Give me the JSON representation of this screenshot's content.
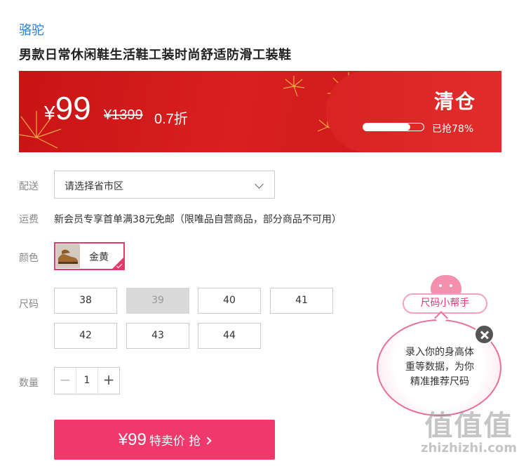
{
  "brand": "骆驼",
  "product": {
    "title": "男款日常休闲鞋生活鞋工装时尚舒适防滑工装鞋"
  },
  "banner": {
    "currency": "¥",
    "price": "99",
    "original_price": "¥1399",
    "discount": "0.7折",
    "tag": "清仓",
    "sold_progress": 0.78,
    "sold_text": "已抢78%"
  },
  "shipping": {
    "label": "配送",
    "placeholder": "请选择省市区"
  },
  "fee": {
    "label": "运费",
    "text": "新会员专享首单满38元免邮（限唯品自营商品，部分商品不可用）"
  },
  "color": {
    "label": "颜色",
    "selected": "金黄"
  },
  "size": {
    "label": "尺码",
    "options": [
      {
        "value": "38",
        "available": true
      },
      {
        "value": "39",
        "available": false
      },
      {
        "value": "40",
        "available": true
      },
      {
        "value": "41",
        "available": true
      },
      {
        "value": "42",
        "available": true
      },
      {
        "value": "43",
        "available": true
      },
      {
        "value": "44",
        "available": true
      }
    ]
  },
  "quantity": {
    "label": "数量",
    "value": "1",
    "minus": "−",
    "plus": "+"
  },
  "buy_button": {
    "price": "¥99",
    "text": "特卖价 抢"
  },
  "size_helper": {
    "pill": "尺码小帮手",
    "bubble_lines": [
      "录入你的身高体",
      "重等数据，为你",
      "精准推荐尺码"
    ]
  },
  "watermark": {
    "glyphs": "值值值",
    "site": "zhizhizhi.com"
  },
  "colors": {
    "brand_blue": "#2a7fd4",
    "banner_red": "#d8201f",
    "accent_pink": "#f0386b"
  }
}
